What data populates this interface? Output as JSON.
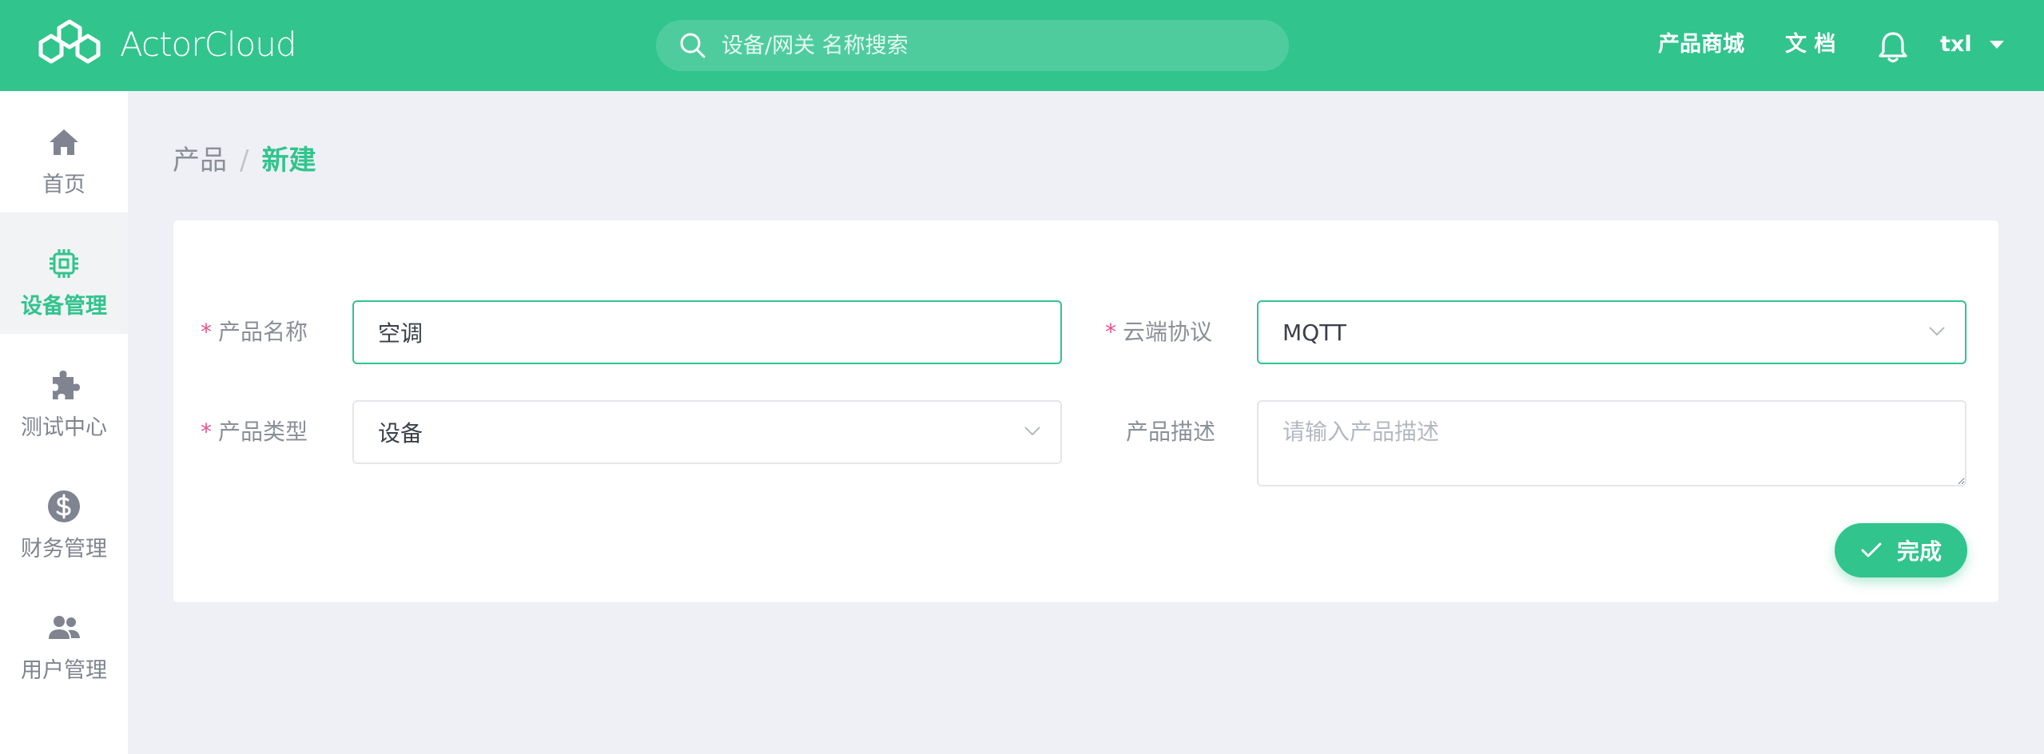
{
  "header": {
    "brand": "ActorCloud",
    "search_placeholder": "设备/网关 名称搜索",
    "nav_links": [
      "产品商城",
      "文 档"
    ],
    "user_name": "txl",
    "accent_color": "#31C48D"
  },
  "sidebar": {
    "items": [
      {
        "label": "首页",
        "icon": "home-icon",
        "active": false
      },
      {
        "label": "设备管理",
        "icon": "chip-icon",
        "active": true
      },
      {
        "label": "测试中心",
        "icon": "puzzle-icon",
        "active": false
      },
      {
        "label": "财务管理",
        "icon": "dollar-icon",
        "active": false
      },
      {
        "label": "用户管理",
        "icon": "users-icon",
        "active": false
      }
    ]
  },
  "breadcrumb": {
    "parent": "产品",
    "separator": "/",
    "current": "新建"
  },
  "form": {
    "required_mark": "*",
    "product_name": {
      "label": "产品名称",
      "value": "空调",
      "required": true
    },
    "cloud_protocol": {
      "label": "云端协议",
      "value": "MQTT",
      "required": true
    },
    "product_type": {
      "label": "产品类型",
      "value": "设备",
      "required": true
    },
    "product_desc": {
      "label": "产品描述",
      "placeholder": "请输入产品描述",
      "required": false
    },
    "submit_label": "完成"
  }
}
